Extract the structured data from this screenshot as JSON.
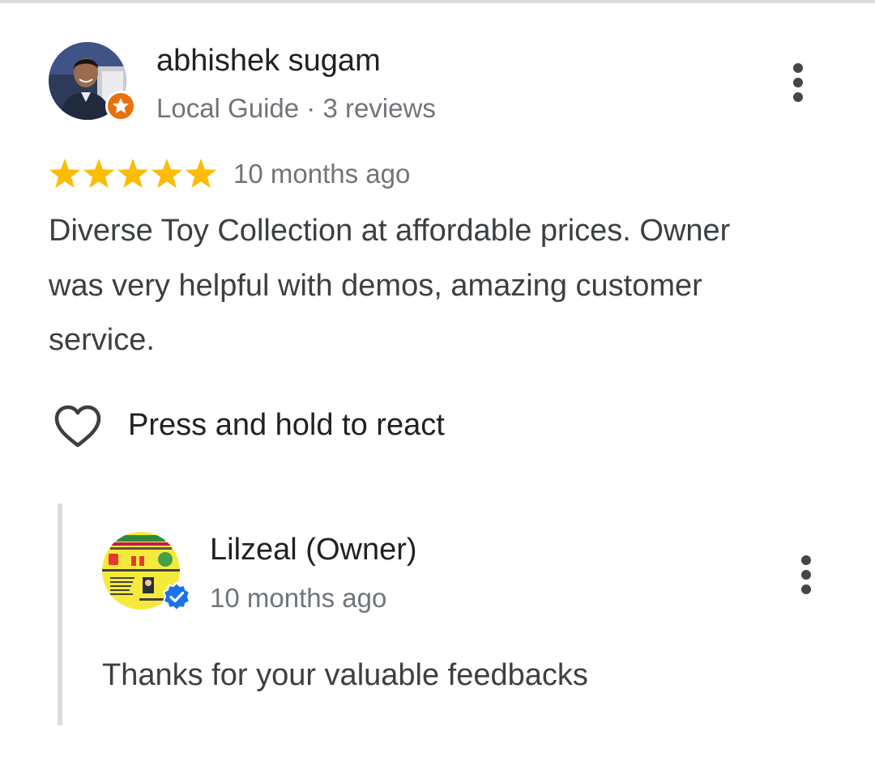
{
  "review": {
    "reviewer_name": "abhishek sugam",
    "reviewer_meta": "Local Guide · 3 reviews",
    "rating": 5,
    "rating_max": 5,
    "time": "10 months ago",
    "text": "Diverse Toy Collection at affordable prices. Owner was very helpful with demos, amazing customer service.",
    "react_label": "Press and hold to react"
  },
  "owner_response": {
    "name": "Lilzeal (Owner)",
    "time": "10 months ago",
    "text": "Thanks for your valuable feedbacks"
  },
  "colors": {
    "star": "#fbbc04",
    "local_guide_badge": "#e8710a",
    "verified_badge": "#1a73e8",
    "secondary_text": "#70757a",
    "primary_text": "#202124",
    "reply_bar": "#dadce0",
    "logo_yellow": "#f5ea3c"
  },
  "icons": {
    "review_more": "more-vert-icon",
    "reply_more": "more-vert-icon",
    "react": "heart-outline-icon",
    "local_guide": "local-guide-star-badge-icon",
    "verified": "verified-check-badge-icon"
  }
}
